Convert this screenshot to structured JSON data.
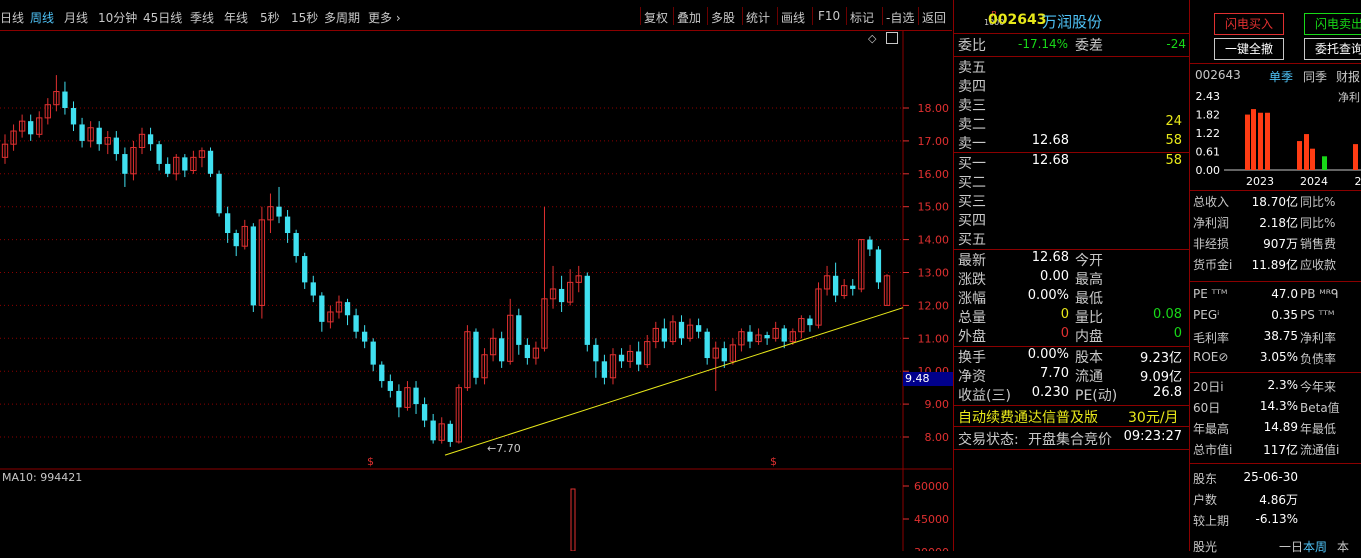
{
  "periods": [
    "日线",
    "周线",
    "月线",
    "10分钟",
    "45日线",
    "季线",
    "年线",
    "5秒",
    "15秒",
    "多周期",
    "更多"
  ],
  "active_period": "周线",
  "tools": [
    "复权",
    "叠加",
    "多股",
    "统计",
    "画线",
    "F10",
    "标记",
    "-自选",
    "返回"
  ],
  "chart": {
    "yticks": [
      "18.00",
      "17.00",
      "16.00",
      "15.00",
      "14.00",
      "13.00",
      "12.00",
      "11.00",
      "10.00",
      "9.00",
      "8.00"
    ],
    "last_price_tag": "9.48",
    "low_marker": "←7.70",
    "s_marker": "$",
    "indicator_label": "MA10: 994421",
    "vol_ticks": [
      "60000",
      "45000",
      "30000"
    ],
    "colors": {
      "up": "#e03030",
      "down": "#40e0f0",
      "trend": "#e8e81a",
      "grid": "#8b0000"
    },
    "candles": [
      {
        "o": 16.5,
        "c": 16.9,
        "h": 17.2,
        "l": 16.3
      },
      {
        "o": 16.9,
        "c": 17.3,
        "h": 17.5,
        "l": 16.7
      },
      {
        "o": 17.3,
        "c": 17.6,
        "h": 17.8,
        "l": 17.1
      },
      {
        "o": 17.6,
        "c": 17.2,
        "h": 17.8,
        "l": 17.0
      },
      {
        "o": 17.2,
        "c": 17.7,
        "h": 17.9,
        "l": 17.1
      },
      {
        "o": 17.7,
        "c": 18.1,
        "h": 18.3,
        "l": 17.5
      },
      {
        "o": 18.1,
        "c": 18.5,
        "h": 19.0,
        "l": 17.9
      },
      {
        "o": 18.5,
        "c": 18.0,
        "h": 18.8,
        "l": 17.8
      },
      {
        "o": 18.0,
        "c": 17.5,
        "h": 18.2,
        "l": 17.3
      },
      {
        "o": 17.5,
        "c": 17.0,
        "h": 17.7,
        "l": 16.8
      },
      {
        "o": 17.0,
        "c": 17.4,
        "h": 17.6,
        "l": 16.8
      },
      {
        "o": 17.4,
        "c": 16.9,
        "h": 17.6,
        "l": 16.7
      },
      {
        "o": 16.9,
        "c": 17.1,
        "h": 17.3,
        "l": 16.6
      },
      {
        "o": 17.1,
        "c": 16.6,
        "h": 17.3,
        "l": 16.4
      },
      {
        "o": 16.6,
        "c": 16.0,
        "h": 16.8,
        "l": 15.6
      },
      {
        "o": 16.0,
        "c": 16.8,
        "h": 17.0,
        "l": 15.8
      },
      {
        "o": 16.8,
        "c": 17.2,
        "h": 17.4,
        "l": 16.6
      },
      {
        "o": 17.2,
        "c": 16.9,
        "h": 17.4,
        "l": 16.7
      },
      {
        "o": 16.9,
        "c": 16.3,
        "h": 17.0,
        "l": 16.1
      },
      {
        "o": 16.3,
        "c": 16.0,
        "h": 16.5,
        "l": 15.9
      },
      {
        "o": 16.0,
        "c": 16.5,
        "h": 16.6,
        "l": 15.8
      },
      {
        "o": 16.5,
        "c": 16.1,
        "h": 16.6,
        "l": 15.9
      },
      {
        "o": 16.1,
        "c": 16.5,
        "h": 16.7,
        "l": 16.0
      },
      {
        "o": 16.5,
        "c": 16.7,
        "h": 16.8,
        "l": 16.2
      },
      {
        "o": 16.7,
        "c": 16.0,
        "h": 16.8,
        "l": 15.9
      },
      {
        "o": 16.0,
        "c": 14.8,
        "h": 16.1,
        "l": 14.7
      },
      {
        "o": 14.8,
        "c": 14.2,
        "h": 15.0,
        "l": 13.9
      },
      {
        "o": 14.2,
        "c": 13.8,
        "h": 14.3,
        "l": 13.5
      },
      {
        "o": 13.8,
        "c": 14.4,
        "h": 14.6,
        "l": 13.7
      },
      {
        "o": 14.4,
        "c": 12.0,
        "h": 14.5,
        "l": 11.8
      },
      {
        "o": 12.0,
        "c": 14.6,
        "h": 15.0,
        "l": 11.6
      },
      {
        "o": 14.6,
        "c": 15.0,
        "h": 15.4,
        "l": 14.2
      },
      {
        "o": 15.0,
        "c": 14.7,
        "h": 15.6,
        "l": 14.5
      },
      {
        "o": 14.7,
        "c": 14.2,
        "h": 14.9,
        "l": 13.9
      },
      {
        "o": 14.2,
        "c": 13.5,
        "h": 14.3,
        "l": 13.3
      },
      {
        "o": 13.5,
        "c": 12.7,
        "h": 13.6,
        "l": 12.5
      },
      {
        "o": 12.7,
        "c": 12.3,
        "h": 12.9,
        "l": 12.1
      },
      {
        "o": 12.3,
        "c": 11.5,
        "h": 12.4,
        "l": 11.2
      },
      {
        "o": 11.5,
        "c": 11.8,
        "h": 12.0,
        "l": 11.3
      },
      {
        "o": 11.8,
        "c": 12.1,
        "h": 12.3,
        "l": 11.6
      },
      {
        "o": 12.1,
        "c": 11.7,
        "h": 12.2,
        "l": 11.4
      },
      {
        "o": 11.7,
        "c": 11.2,
        "h": 11.9,
        "l": 11.0
      },
      {
        "o": 11.2,
        "c": 10.9,
        "h": 11.4,
        "l": 10.7
      },
      {
        "o": 10.9,
        "c": 10.2,
        "h": 11.0,
        "l": 10.0
      },
      {
        "o": 10.2,
        "c": 9.7,
        "h": 10.3,
        "l": 9.5
      },
      {
        "o": 9.7,
        "c": 9.4,
        "h": 9.9,
        "l": 9.2
      },
      {
        "o": 9.4,
        "c": 8.9,
        "h": 9.6,
        "l": 8.6
      },
      {
        "o": 8.9,
        "c": 9.5,
        "h": 9.7,
        "l": 8.8
      },
      {
        "o": 9.5,
        "c": 9.0,
        "h": 9.7,
        "l": 8.7
      },
      {
        "o": 9.0,
        "c": 8.5,
        "h": 9.2,
        "l": 8.3
      },
      {
        "o": 8.5,
        "c": 7.9,
        "h": 8.7,
        "l": 7.8
      },
      {
        "o": 7.9,
        "c": 8.4,
        "h": 8.6,
        "l": 7.8
      },
      {
        "o": 8.4,
        "c": 7.85,
        "h": 8.5,
        "l": 7.7
      },
      {
        "o": 7.85,
        "c": 9.5,
        "h": 9.6,
        "l": 7.8
      },
      {
        "o": 9.5,
        "c": 11.2,
        "h": 11.4,
        "l": 9.4
      },
      {
        "o": 11.2,
        "c": 9.8,
        "h": 11.3,
        "l": 9.6
      },
      {
        "o": 9.8,
        "c": 10.5,
        "h": 10.7,
        "l": 9.6
      },
      {
        "o": 10.5,
        "c": 11.0,
        "h": 11.3,
        "l": 10.3
      },
      {
        "o": 11.0,
        "c": 10.3,
        "h": 11.2,
        "l": 10.1
      },
      {
        "o": 10.3,
        "c": 11.7,
        "h": 12.2,
        "l": 10.2
      },
      {
        "o": 11.7,
        "c": 10.8,
        "h": 11.9,
        "l": 10.5
      },
      {
        "o": 10.8,
        "c": 10.4,
        "h": 11.0,
        "l": 10.2
      },
      {
        "o": 10.4,
        "c": 10.7,
        "h": 10.9,
        "l": 10.2
      },
      {
        "o": 10.7,
        "c": 12.2,
        "h": 15.0,
        "l": 10.6
      },
      {
        "o": 12.2,
        "c": 12.5,
        "h": 13.2,
        "l": 11.9
      },
      {
        "o": 12.5,
        "c": 12.1,
        "h": 12.9,
        "l": 11.8
      },
      {
        "o": 12.1,
        "c": 12.7,
        "h": 13.1,
        "l": 12.0
      },
      {
        "o": 12.7,
        "c": 12.9,
        "h": 13.2,
        "l": 12.4
      },
      {
        "o": 12.9,
        "c": 10.8,
        "h": 13.0,
        "l": 10.6
      },
      {
        "o": 10.8,
        "c": 10.3,
        "h": 11.0,
        "l": 9.8
      },
      {
        "o": 10.3,
        "c": 9.8,
        "h": 10.5,
        "l": 9.6
      },
      {
        "o": 9.8,
        "c": 10.5,
        "h": 10.7,
        "l": 9.6
      },
      {
        "o": 10.5,
        "c": 10.3,
        "h": 10.7,
        "l": 10.1
      },
      {
        "o": 10.3,
        "c": 10.6,
        "h": 10.8,
        "l": 10.1
      },
      {
        "o": 10.6,
        "c": 10.2,
        "h": 10.9,
        "l": 10.0
      },
      {
        "o": 10.2,
        "c": 10.9,
        "h": 11.1,
        "l": 10.1
      },
      {
        "o": 10.9,
        "c": 11.3,
        "h": 11.5,
        "l": 10.7
      },
      {
        "o": 11.3,
        "c": 10.9,
        "h": 11.6,
        "l": 10.7
      },
      {
        "o": 10.9,
        "c": 11.5,
        "h": 11.7,
        "l": 10.8
      },
      {
        "o": 11.5,
        "c": 11.0,
        "h": 11.7,
        "l": 10.8
      },
      {
        "o": 11.0,
        "c": 11.4,
        "h": 11.6,
        "l": 10.9
      },
      {
        "o": 11.4,
        "c": 11.2,
        "h": 11.6,
        "l": 11.0
      },
      {
        "o": 11.2,
        "c": 10.4,
        "h": 11.3,
        "l": 10.2
      },
      {
        "o": 10.4,
        "c": 10.7,
        "h": 10.9,
        "l": 9.4
      },
      {
        "o": 10.7,
        "c": 10.3,
        "h": 10.9,
        "l": 10.1
      },
      {
        "o": 10.3,
        "c": 10.8,
        "h": 11.0,
        "l": 10.2
      },
      {
        "o": 10.8,
        "c": 11.2,
        "h": 11.3,
        "l": 10.6
      },
      {
        "o": 11.2,
        "c": 10.9,
        "h": 11.4,
        "l": 10.7
      },
      {
        "o": 10.9,
        "c": 11.1,
        "h": 11.3,
        "l": 10.8
      },
      {
        "o": 11.1,
        "c": 11.0,
        "h": 11.2,
        "l": 10.8
      },
      {
        "o": 11.0,
        "c": 11.3,
        "h": 11.5,
        "l": 10.9
      },
      {
        "o": 11.3,
        "c": 10.9,
        "h": 11.4,
        "l": 10.7
      },
      {
        "o": 10.9,
        "c": 11.2,
        "h": 11.3,
        "l": 10.8
      },
      {
        "o": 11.2,
        "c": 11.6,
        "h": 11.7,
        "l": 11.0
      },
      {
        "o": 11.6,
        "c": 11.4,
        "h": 11.7,
        "l": 11.2
      },
      {
        "o": 11.4,
        "c": 12.5,
        "h": 12.7,
        "l": 11.3
      },
      {
        "o": 12.5,
        "c": 12.9,
        "h": 13.2,
        "l": 12.3
      },
      {
        "o": 12.9,
        "c": 12.3,
        "h": 13.3,
        "l": 12.1
      },
      {
        "o": 12.3,
        "c": 12.6,
        "h": 12.8,
        "l": 12.2
      },
      {
        "o": 12.6,
        "c": 12.5,
        "h": 12.8,
        "l": 12.3
      },
      {
        "o": 12.5,
        "c": 14.0,
        "h": 14.0,
        "l": 12.4
      },
      {
        "o": 14.0,
        "c": 13.7,
        "h": 14.1,
        "l": 13.5
      },
      {
        "o": 13.7,
        "c": 12.7,
        "h": 13.8,
        "l": 12.5
      },
      {
        "o": 12.0,
        "c": 12.9,
        "h": 12.95,
        "l": 12.0
      }
    ]
  },
  "quote": {
    "badge_top": "R",
    "badge_bottom": "1000",
    "code": "002643",
    "name": "万润股份",
    "weibi_label": "委比",
    "weibi": "-17.14%",
    "weicha_label": "委差",
    "weicha": "-24",
    "sells": [
      {
        "label": "卖五",
        "price": "",
        "vol": ""
      },
      {
        "label": "卖四",
        "price": "",
        "vol": ""
      },
      {
        "label": "卖三",
        "price": "",
        "vol": ""
      },
      {
        "label": "卖二",
        "price": "",
        "vol": "24"
      },
      {
        "label": "卖一",
        "price": "12.68",
        "vol": "58"
      }
    ],
    "buys": [
      {
        "label": "买一",
        "price": "12.68",
        "vol": "58"
      },
      {
        "label": "买二",
        "price": "",
        "vol": ""
      },
      {
        "label": "买三",
        "price": "",
        "vol": ""
      },
      {
        "label": "买四",
        "price": "",
        "vol": ""
      },
      {
        "label": "买五",
        "price": "",
        "vol": ""
      }
    ],
    "stats": [
      {
        "l1": "最新",
        "v1": "12.68",
        "l2": "今开",
        "v2": ""
      },
      {
        "l1": "涨跌",
        "v1": "0.00",
        "l2": "最高",
        "v2": ""
      },
      {
        "l1": "涨幅",
        "v1": "0.00%",
        "l2": "最低",
        "v2": ""
      },
      {
        "l1": "总量",
        "v1": "0",
        "l2": "量比",
        "v2": "0.08"
      },
      {
        "l1": "外盘",
        "v1": "0",
        "l2": "内盘",
        "v2": "0"
      }
    ],
    "stats2": [
      {
        "l1": "换手",
        "v1": "0.00%",
        "l2": "股本",
        "v2": "9.23亿"
      },
      {
        "l1": "净资",
        "v1": "7.70",
        "l2": "流通",
        "v2": "9.09亿"
      },
      {
        "l1": "收益(三)",
        "v1": "0.230",
        "l2": "PE(动)",
        "v2": "26.8"
      }
    ],
    "promo": "自动续费通达信普及版",
    "promo_price": "30元/月",
    "status_label": "交易状态:",
    "status": "开盘集合竞价",
    "time": "09:23:27"
  },
  "fin": {
    "btn_buy": "闪电买入",
    "btn_sell": "闪电卖出",
    "btn_cancel_all": "一键全撤",
    "btn_query": "委托查询",
    "code": "002643",
    "tabs": [
      "单季",
      "同季",
      "财报"
    ],
    "mini_label": "净利",
    "mini_yticks": [
      "2.43",
      "1.82",
      "1.22",
      "0.61",
      "0.00"
    ],
    "mini_years": [
      "2023",
      "2024",
      "2"
    ],
    "bars": [
      {
        "v": 1.82,
        "c": "#ff3c14"
      },
      {
        "v": 2.0,
        "c": "#ff3c14"
      },
      {
        "v": 1.88,
        "c": "#ff3c14"
      },
      {
        "v": 1.88,
        "c": "#ff3c14"
      },
      {
        "v": 0.95,
        "c": "#ff3c14"
      },
      {
        "v": 1.18,
        "c": "#ff3c14"
      },
      {
        "v": 0.7,
        "c": "#ff3c14"
      },
      {
        "v": 0.45,
        "c": "#18d818"
      },
      {
        "v": 0.85,
        "c": "#ff3c14"
      }
    ],
    "rows": [
      {
        "l": "总收入",
        "v": "18.70亿",
        "r": "同比%"
      },
      {
        "l": "净利润",
        "v": "2.18亿",
        "r": "同比%"
      },
      {
        "l": "非经损",
        "v": "907万",
        "r": "销售费"
      },
      {
        "l": "货币金i",
        "v": "11.89亿",
        "r": "应收款"
      }
    ],
    "rows2": [
      {
        "l": "PE ᵀᵀᴹ",
        "v": "47.0",
        "r": "PB ᴹᴿᑫ"
      },
      {
        "l": "PEGⁱ",
        "v": "0.35",
        "r": "PS ᵀᵀᴹ"
      },
      {
        "l": "毛利率",
        "v": "38.75",
        "r": "净利率"
      },
      {
        "l": "ROE⊘",
        "v": "3.05%",
        "r": "负债率"
      }
    ],
    "rows3": [
      {
        "l": "20日i",
        "v": "2.3%",
        "r": "今年来"
      },
      {
        "l": "60日",
        "v": "14.3%",
        "r": "Beta值"
      },
      {
        "l": "年最高",
        "v": "14.89",
        "r": "年最低"
      },
      {
        "l": "总市值i",
        "v": "117亿",
        "r": "流通值i"
      }
    ],
    "rows4": [
      {
        "l": "股东",
        "v": "25-06-30",
        "r": ""
      },
      {
        "l": "户数",
        "v": "4.86万",
        "r": ""
      },
      {
        "l": "较上期",
        "v": "-6.13%",
        "r": ""
      }
    ],
    "bottom_l": "股光",
    "bottom_m": "一日",
    "bottom_tab": "本周",
    "bottom_r": "本"
  }
}
